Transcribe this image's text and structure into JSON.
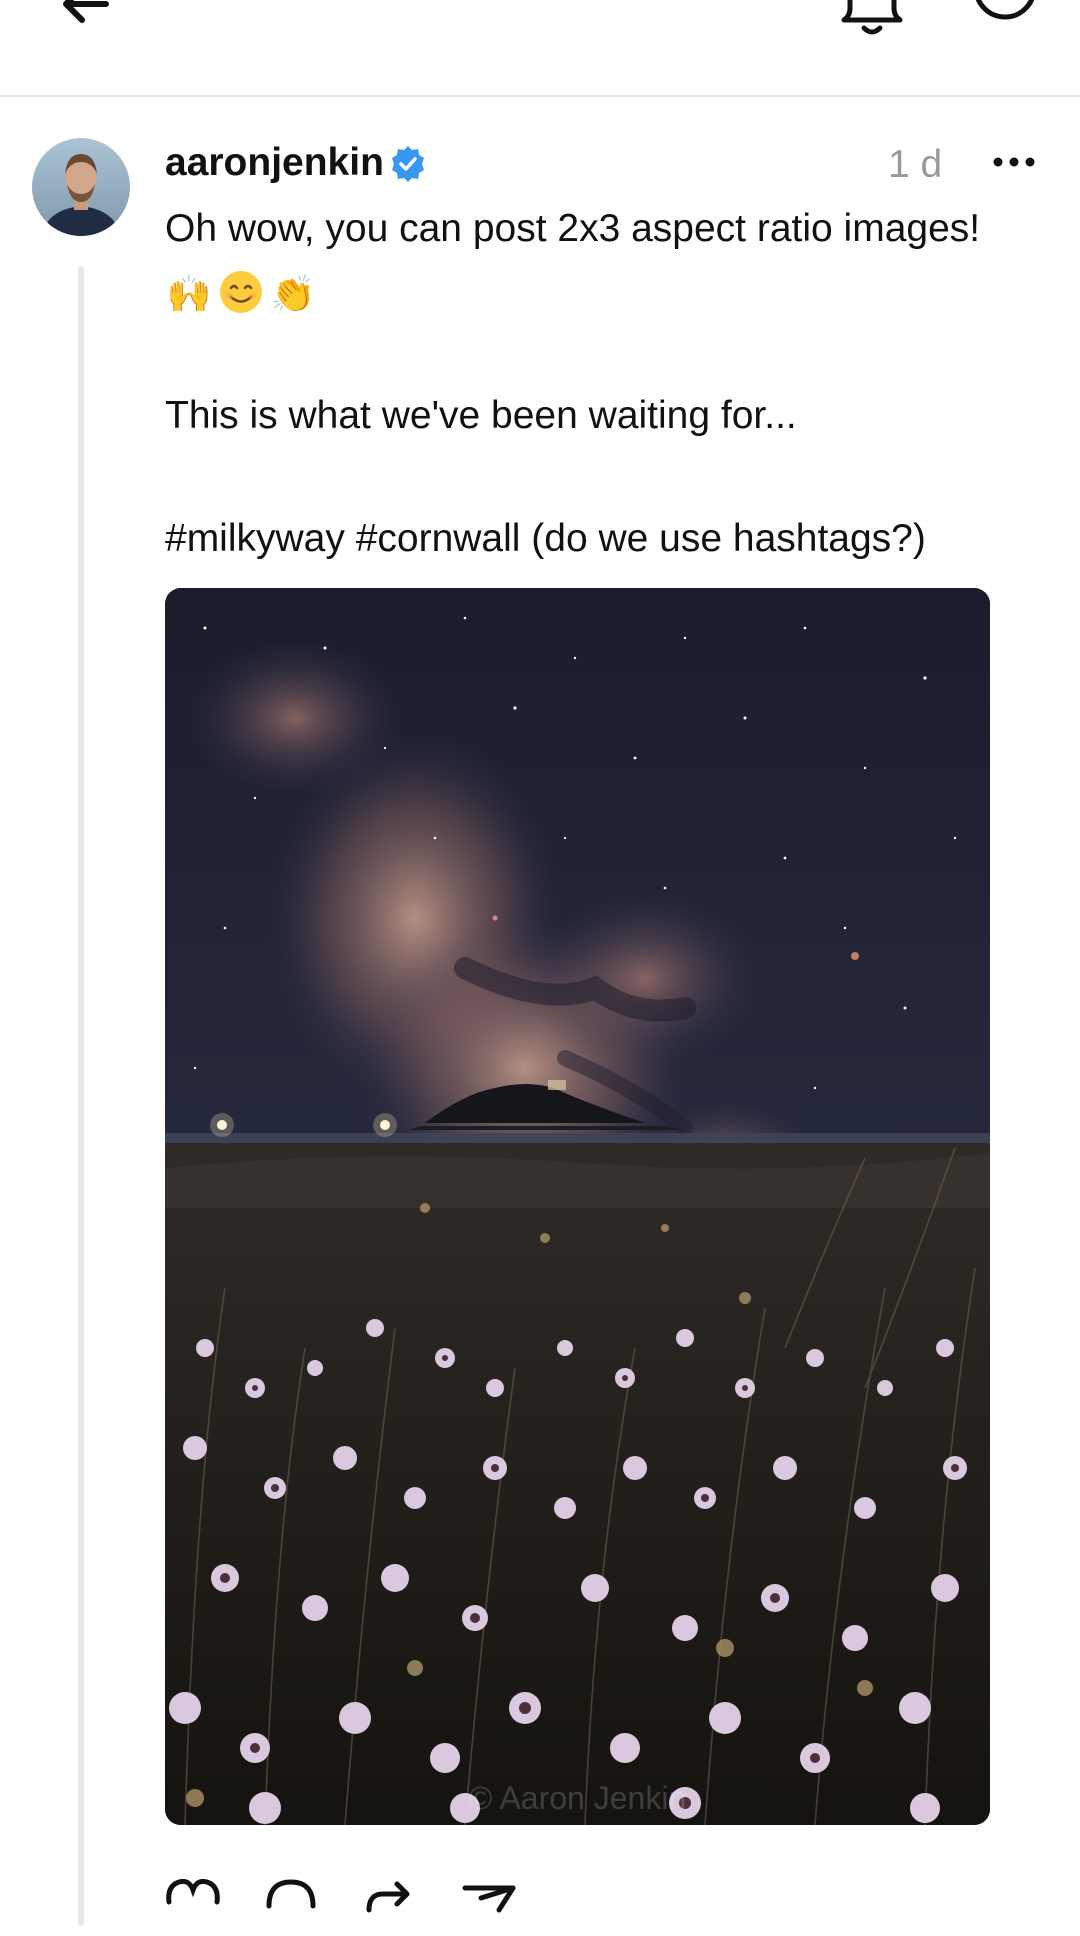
{
  "post": {
    "username": "aaronjenkin",
    "timestamp": "1 d",
    "text_line1": "Oh wow, you can post 2x3 aspect ratio images!",
    "emojis": [
      "🙌",
      "😊",
      "👏"
    ],
    "text_line2": "This is what we've been waiting for...",
    "text_line3": "#milkyway #cornwall (do we use hashtags?)",
    "image_watermark": "© Aaron Jenkin"
  },
  "icons": {
    "back": "back-arrow-icon",
    "notifications": "bell-icon",
    "more": "more-circle-icon",
    "verified": "verified-badge-icon",
    "post_more": "ellipsis-icon",
    "like": "heart-icon",
    "comment": "comment-icon",
    "repost": "repost-icon",
    "share": "send-icon"
  },
  "colors": {
    "verified": "#3897f0",
    "timestamp": "#999999",
    "divider": "#e6e6e6",
    "thread_line": "#e8e8e8"
  }
}
